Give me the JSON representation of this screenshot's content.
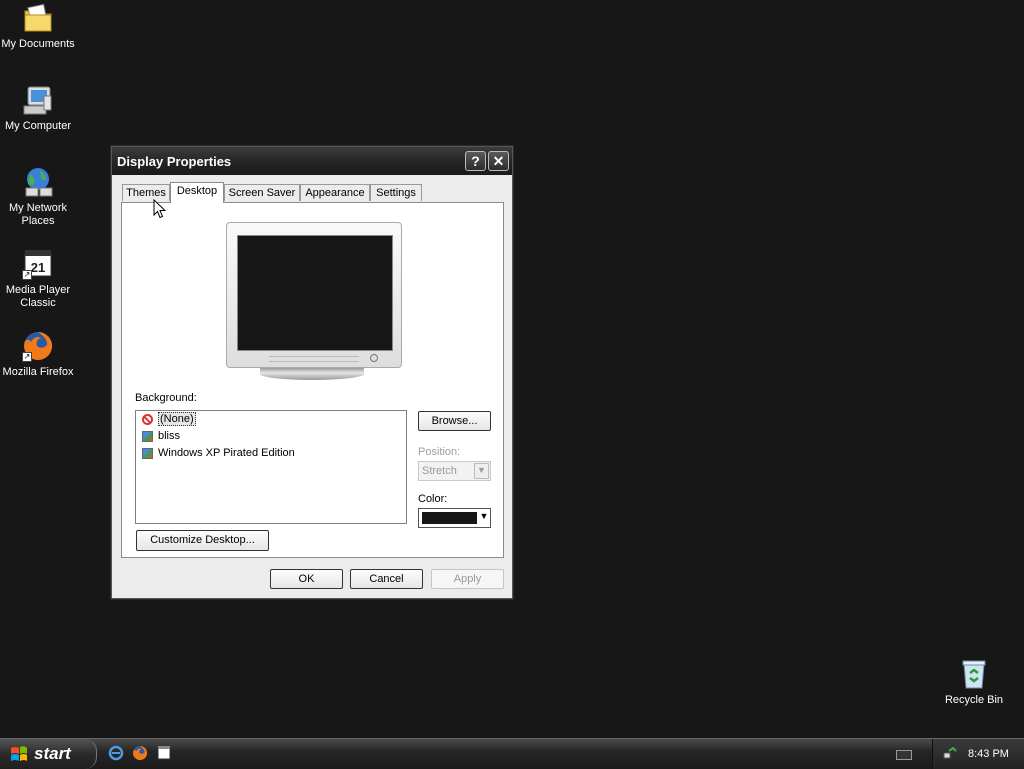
{
  "desktop": {
    "icons": [
      {
        "label": "My Documents",
        "icon": "my-documents-icon"
      },
      {
        "label": "My Computer",
        "icon": "my-computer-icon"
      },
      {
        "label": "My Network Places",
        "icon": "network-places-icon"
      },
      {
        "label": "Media Player Classic",
        "icon": "media-player-icon"
      },
      {
        "label": "Mozilla Firefox",
        "icon": "firefox-icon"
      },
      {
        "label": "Recycle Bin",
        "icon": "recycle-bin-icon"
      }
    ],
    "background_color": "#171717"
  },
  "dialog": {
    "title": "Display Properties",
    "help_glyph": "?",
    "close_glyph": "✕",
    "tabs": [
      {
        "label": "Themes",
        "active": false
      },
      {
        "label": "Desktop",
        "active": true
      },
      {
        "label": "Screen Saver",
        "active": false
      },
      {
        "label": "Appearance",
        "active": false
      },
      {
        "label": "Settings",
        "active": false
      }
    ],
    "background_label": "Background:",
    "background_items": [
      {
        "label": "(None)",
        "icon": "none-icon",
        "selected": true
      },
      {
        "label": "bliss",
        "icon": "bitmap-icon",
        "selected": false
      },
      {
        "label": "Windows XP Pirated Edition",
        "icon": "bitmap-icon",
        "selected": false
      }
    ],
    "browse_label": "Browse...",
    "position_label": "Position:",
    "position_value": "Stretch",
    "position_enabled": false,
    "color_label": "Color:",
    "color_value": "#171717",
    "customize_label": "Customize Desktop...",
    "ok_label": "OK",
    "cancel_label": "Cancel",
    "apply_label": "Apply",
    "apply_enabled": false
  },
  "taskbar": {
    "start_label": "start",
    "quick_launch": [
      "internet-explorer-icon",
      "firefox-icon",
      "media-player-icon"
    ],
    "tray": {
      "clock": "8:43 PM",
      "icons": [
        "keyboard-icon",
        "network-icon"
      ]
    }
  }
}
